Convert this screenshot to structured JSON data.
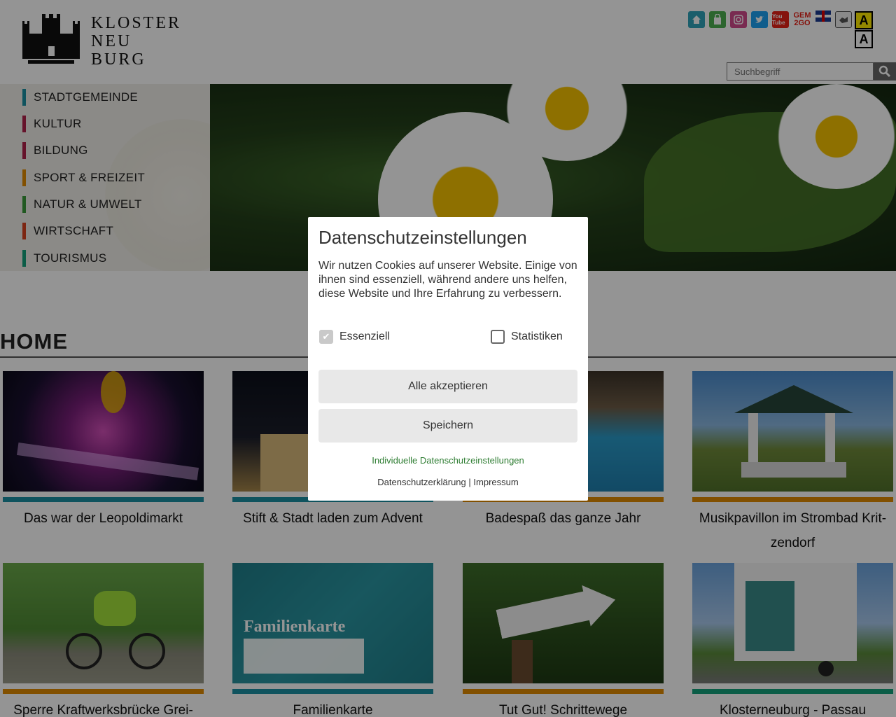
{
  "logo": {
    "lines": [
      "KLOSTER",
      "NEU",
      "BURG"
    ]
  },
  "social": {
    "icons": [
      "house-icon",
      "shopping-bag-icon",
      "instagram-icon",
      "twitter-icon",
      "youtube-icon",
      "gem2go-icon",
      "uk-flag-icon",
      "sign-language-icon"
    ],
    "youtube_label": "You Tube",
    "gem_label_top": "GEM",
    "gem_label_bottom": "2GO",
    "font_btn_label": "A"
  },
  "search": {
    "placeholder": "Suchbegriff"
  },
  "nav": [
    {
      "label": "STADTGEMEINDE",
      "color": "#1b8fa3"
    },
    {
      "label": "KULTUR",
      "color": "#b0224a"
    },
    {
      "label": "BILDUNG",
      "color": "#b0224a"
    },
    {
      "label": "SPORT & FREIZEIT",
      "color": "#e08a00"
    },
    {
      "label": "NATUR & UMWELT",
      "color": "#3a9a3a"
    },
    {
      "label": "WIRTSCHAFT",
      "color": "#d84320"
    },
    {
      "label": "TOURISMUS",
      "color": "#13a07a"
    }
  ],
  "home": {
    "title": "HOME"
  },
  "cards": [
    {
      "title": "Das war der Leopoldimarkt",
      "stripe": "#1b8fa3"
    },
    {
      "title": "Stift & Stadt laden zum Advent",
      "stripe": "#1b8fa3"
    },
    {
      "title": "Badespaß das ganze Jahr",
      "stripe": "#e08a00"
    },
    {
      "title_line1": "Musikpavillon im Strombad Krit-",
      "title_line2": "zendorf",
      "stripe": "#e08a00"
    },
    {
      "title": "Sperre Kraftwerksbrücke Grei-",
      "stripe": "#e08a00"
    },
    {
      "title": "Familienkarte",
      "stripe": "#1b8fa3",
      "overlay_text": "Familienkarte"
    },
    {
      "title": "Tut Gut! Schrittewege",
      "stripe": "#e08a00"
    },
    {
      "title": "Klosterneuburg - Passau",
      "stripe": "#13a07a"
    }
  ],
  "modal": {
    "title": "Datenschutzeinstellungen",
    "text": "Wir nutzen Cookies auf unserer Website. Einige von ihnen sind essenziell, während andere uns helfen, diese Website und Ihre Erfahrung zu verbessern.",
    "check_essential": "Essenziell",
    "check_stats": "Statistiken",
    "btn_accept_all": "Alle akzeptieren",
    "btn_save": "Speichern",
    "link_individual": "Individuelle Datenschutzeinstellungen",
    "link_privacy": "Datenschutzerklärung",
    "separator": "|",
    "link_imprint": "Impressum"
  }
}
